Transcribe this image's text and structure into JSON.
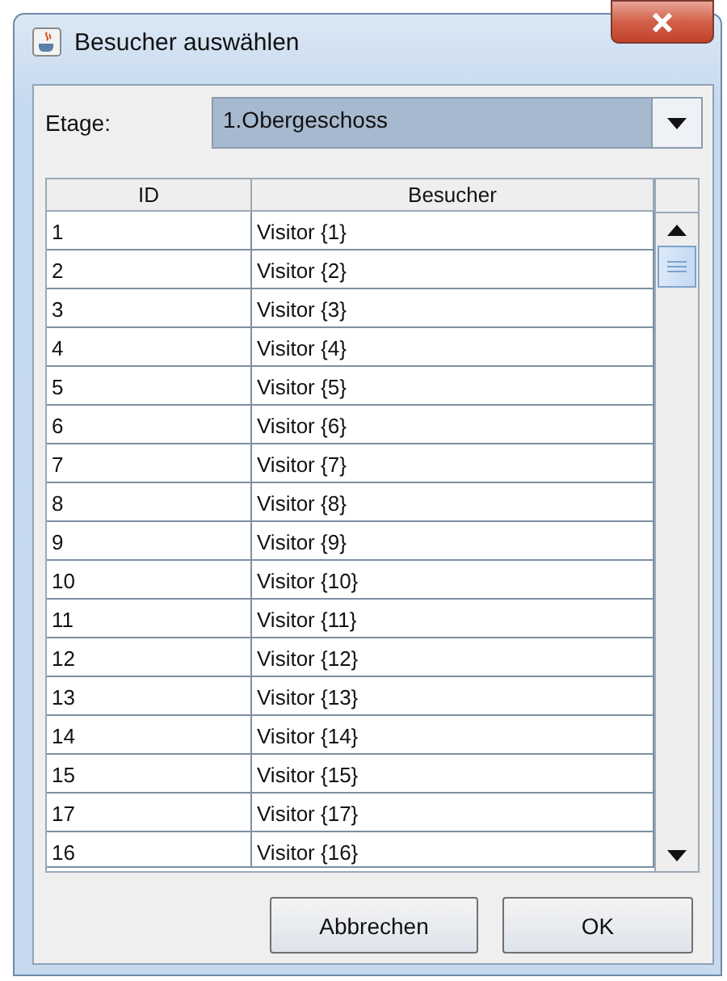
{
  "window": {
    "title": "Besucher auswählen"
  },
  "floor": {
    "label": "Etage:",
    "value": "1.Obergeschoss"
  },
  "table": {
    "columns": [
      "ID",
      "Besucher"
    ],
    "rows": [
      {
        "id": "1",
        "visitor": "Visitor {1}"
      },
      {
        "id": "2",
        "visitor": "Visitor {2}"
      },
      {
        "id": "3",
        "visitor": "Visitor {3}"
      },
      {
        "id": "4",
        "visitor": "Visitor {4}"
      },
      {
        "id": "5",
        "visitor": "Visitor {5}"
      },
      {
        "id": "6",
        "visitor": "Visitor {6}"
      },
      {
        "id": "7",
        "visitor": "Visitor {7}"
      },
      {
        "id": "8",
        "visitor": "Visitor {8}"
      },
      {
        "id": "9",
        "visitor": "Visitor {9}"
      },
      {
        "id": "10",
        "visitor": "Visitor {10}"
      },
      {
        "id": "11",
        "visitor": "Visitor {11}"
      },
      {
        "id": "12",
        "visitor": "Visitor {12}"
      },
      {
        "id": "13",
        "visitor": "Visitor {13}"
      },
      {
        "id": "14",
        "visitor": "Visitor {14}"
      },
      {
        "id": "15",
        "visitor": "Visitor {15}"
      },
      {
        "id": "17",
        "visitor": "Visitor {17}"
      },
      {
        "id": "16",
        "visitor": "Visitor {16}"
      }
    ]
  },
  "buttons": [
    "Abbrechen",
    "OK"
  ]
}
